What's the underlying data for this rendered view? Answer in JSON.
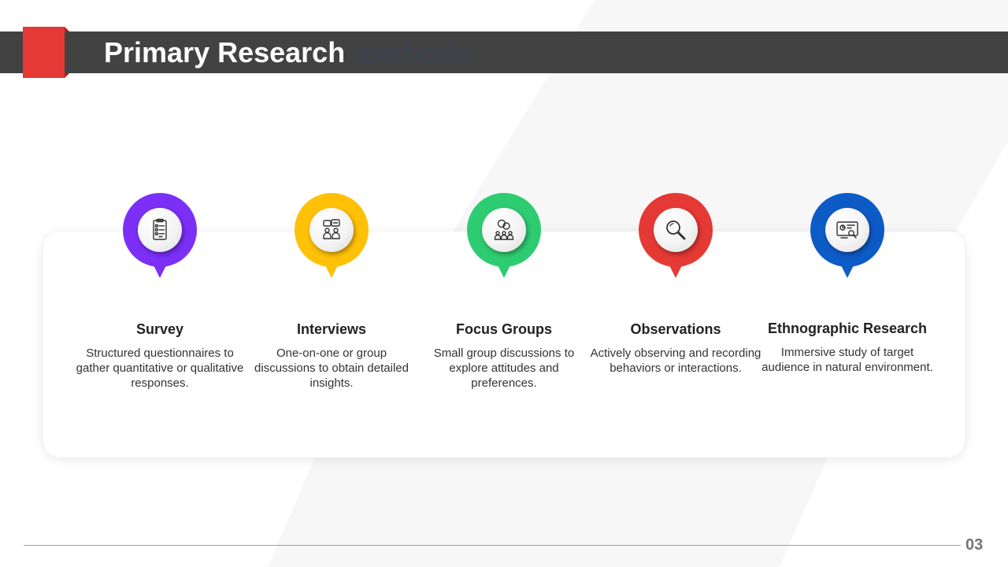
{
  "slide": {
    "title_main": "Primary Research",
    "title_faded": "methods",
    "page_number": "03"
  },
  "methods": [
    {
      "title": "Survey",
      "description": "Structured questionnaires to gather quantitative or qualitative responses.",
      "color": "#7b2ff7",
      "icon": "survey-clipboard-icon"
    },
    {
      "title": "Interviews",
      "description": "One-on-one or group discussions to obtain detailed insights.",
      "color": "#ffc107",
      "icon": "interview-people-icon"
    },
    {
      "title": "Focus Groups",
      "description": "Small group discussions to explore attitudes and preferences.",
      "color": "#2ecc71",
      "icon": "focus-group-icon"
    },
    {
      "title": "Observations",
      "description": "Actively observing and recording behaviors or interactions.",
      "color": "#e53935",
      "icon": "magnifier-icon"
    },
    {
      "title": "Ethnographic Research",
      "description": "Immersive study of target audience in natural environment.",
      "color": "#0d5bc6",
      "icon": "research-screen-icon"
    }
  ]
}
